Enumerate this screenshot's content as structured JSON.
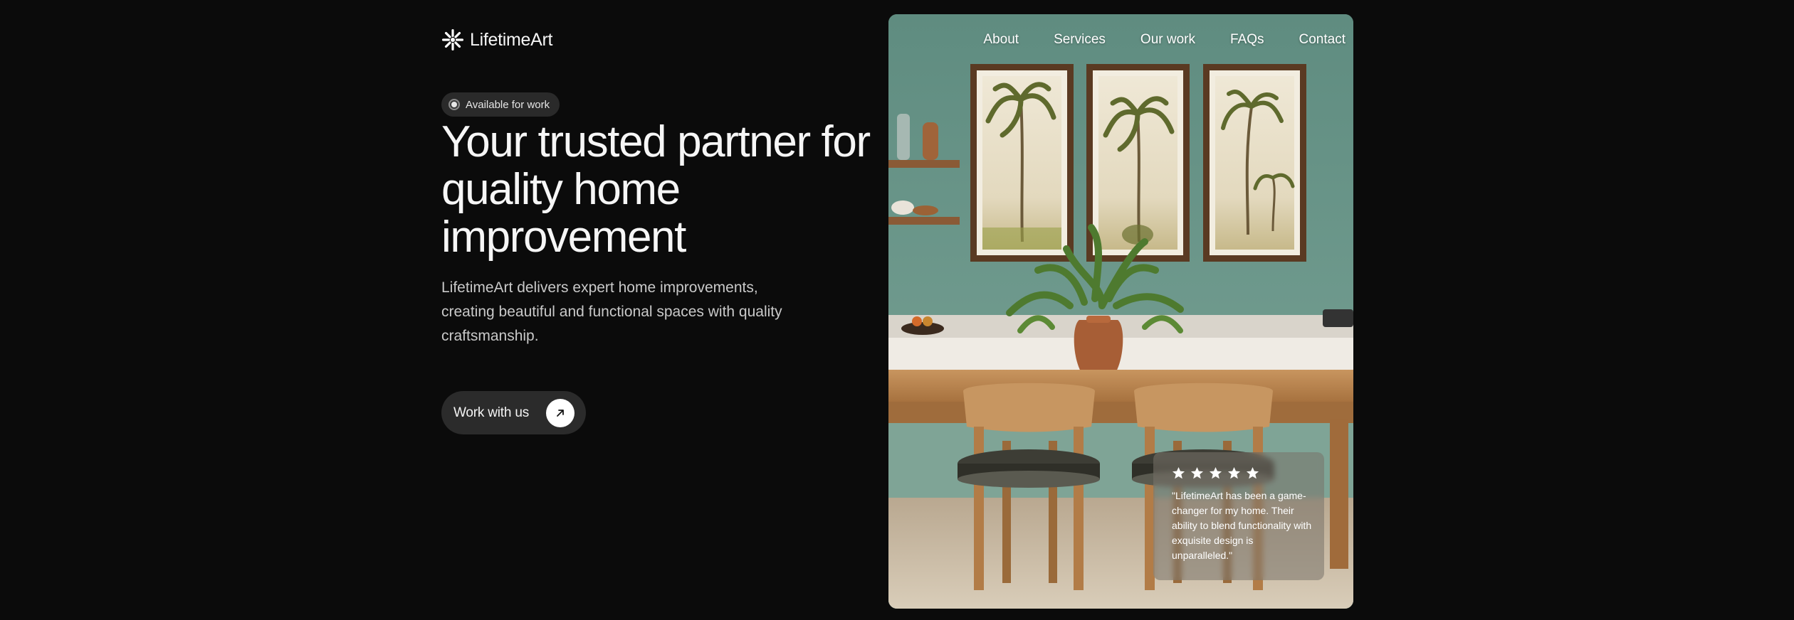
{
  "brand": {
    "name": "LifetimeArt",
    "logo_icon": "sunburst-icon"
  },
  "nav": {
    "items": [
      {
        "label": "About"
      },
      {
        "label": "Services"
      },
      {
        "label": "Our work"
      },
      {
        "label": "FAQs"
      },
      {
        "label": "Contact"
      }
    ]
  },
  "hero": {
    "badge": "Available for work",
    "title": "Your trusted partner for quality home improvement",
    "description": "LifetimeArt delivers expert home improvements, creating beautiful and functional spaces with quality craftsmanship.",
    "cta_label": "Work with us",
    "cta_icon": "arrow-up-right-icon"
  },
  "review": {
    "rating": 5,
    "text": "\"LifetimeArt has been a game-changer for my home. Their ability to blend functionality with exquisite design is unparalleled.\""
  },
  "colors": {
    "background": "#0b0b0b",
    "surface": "#2b2b2b",
    "text": "#f6f6f6",
    "muted_text": "#c9c9c9",
    "wall": "#6f9a8d"
  }
}
